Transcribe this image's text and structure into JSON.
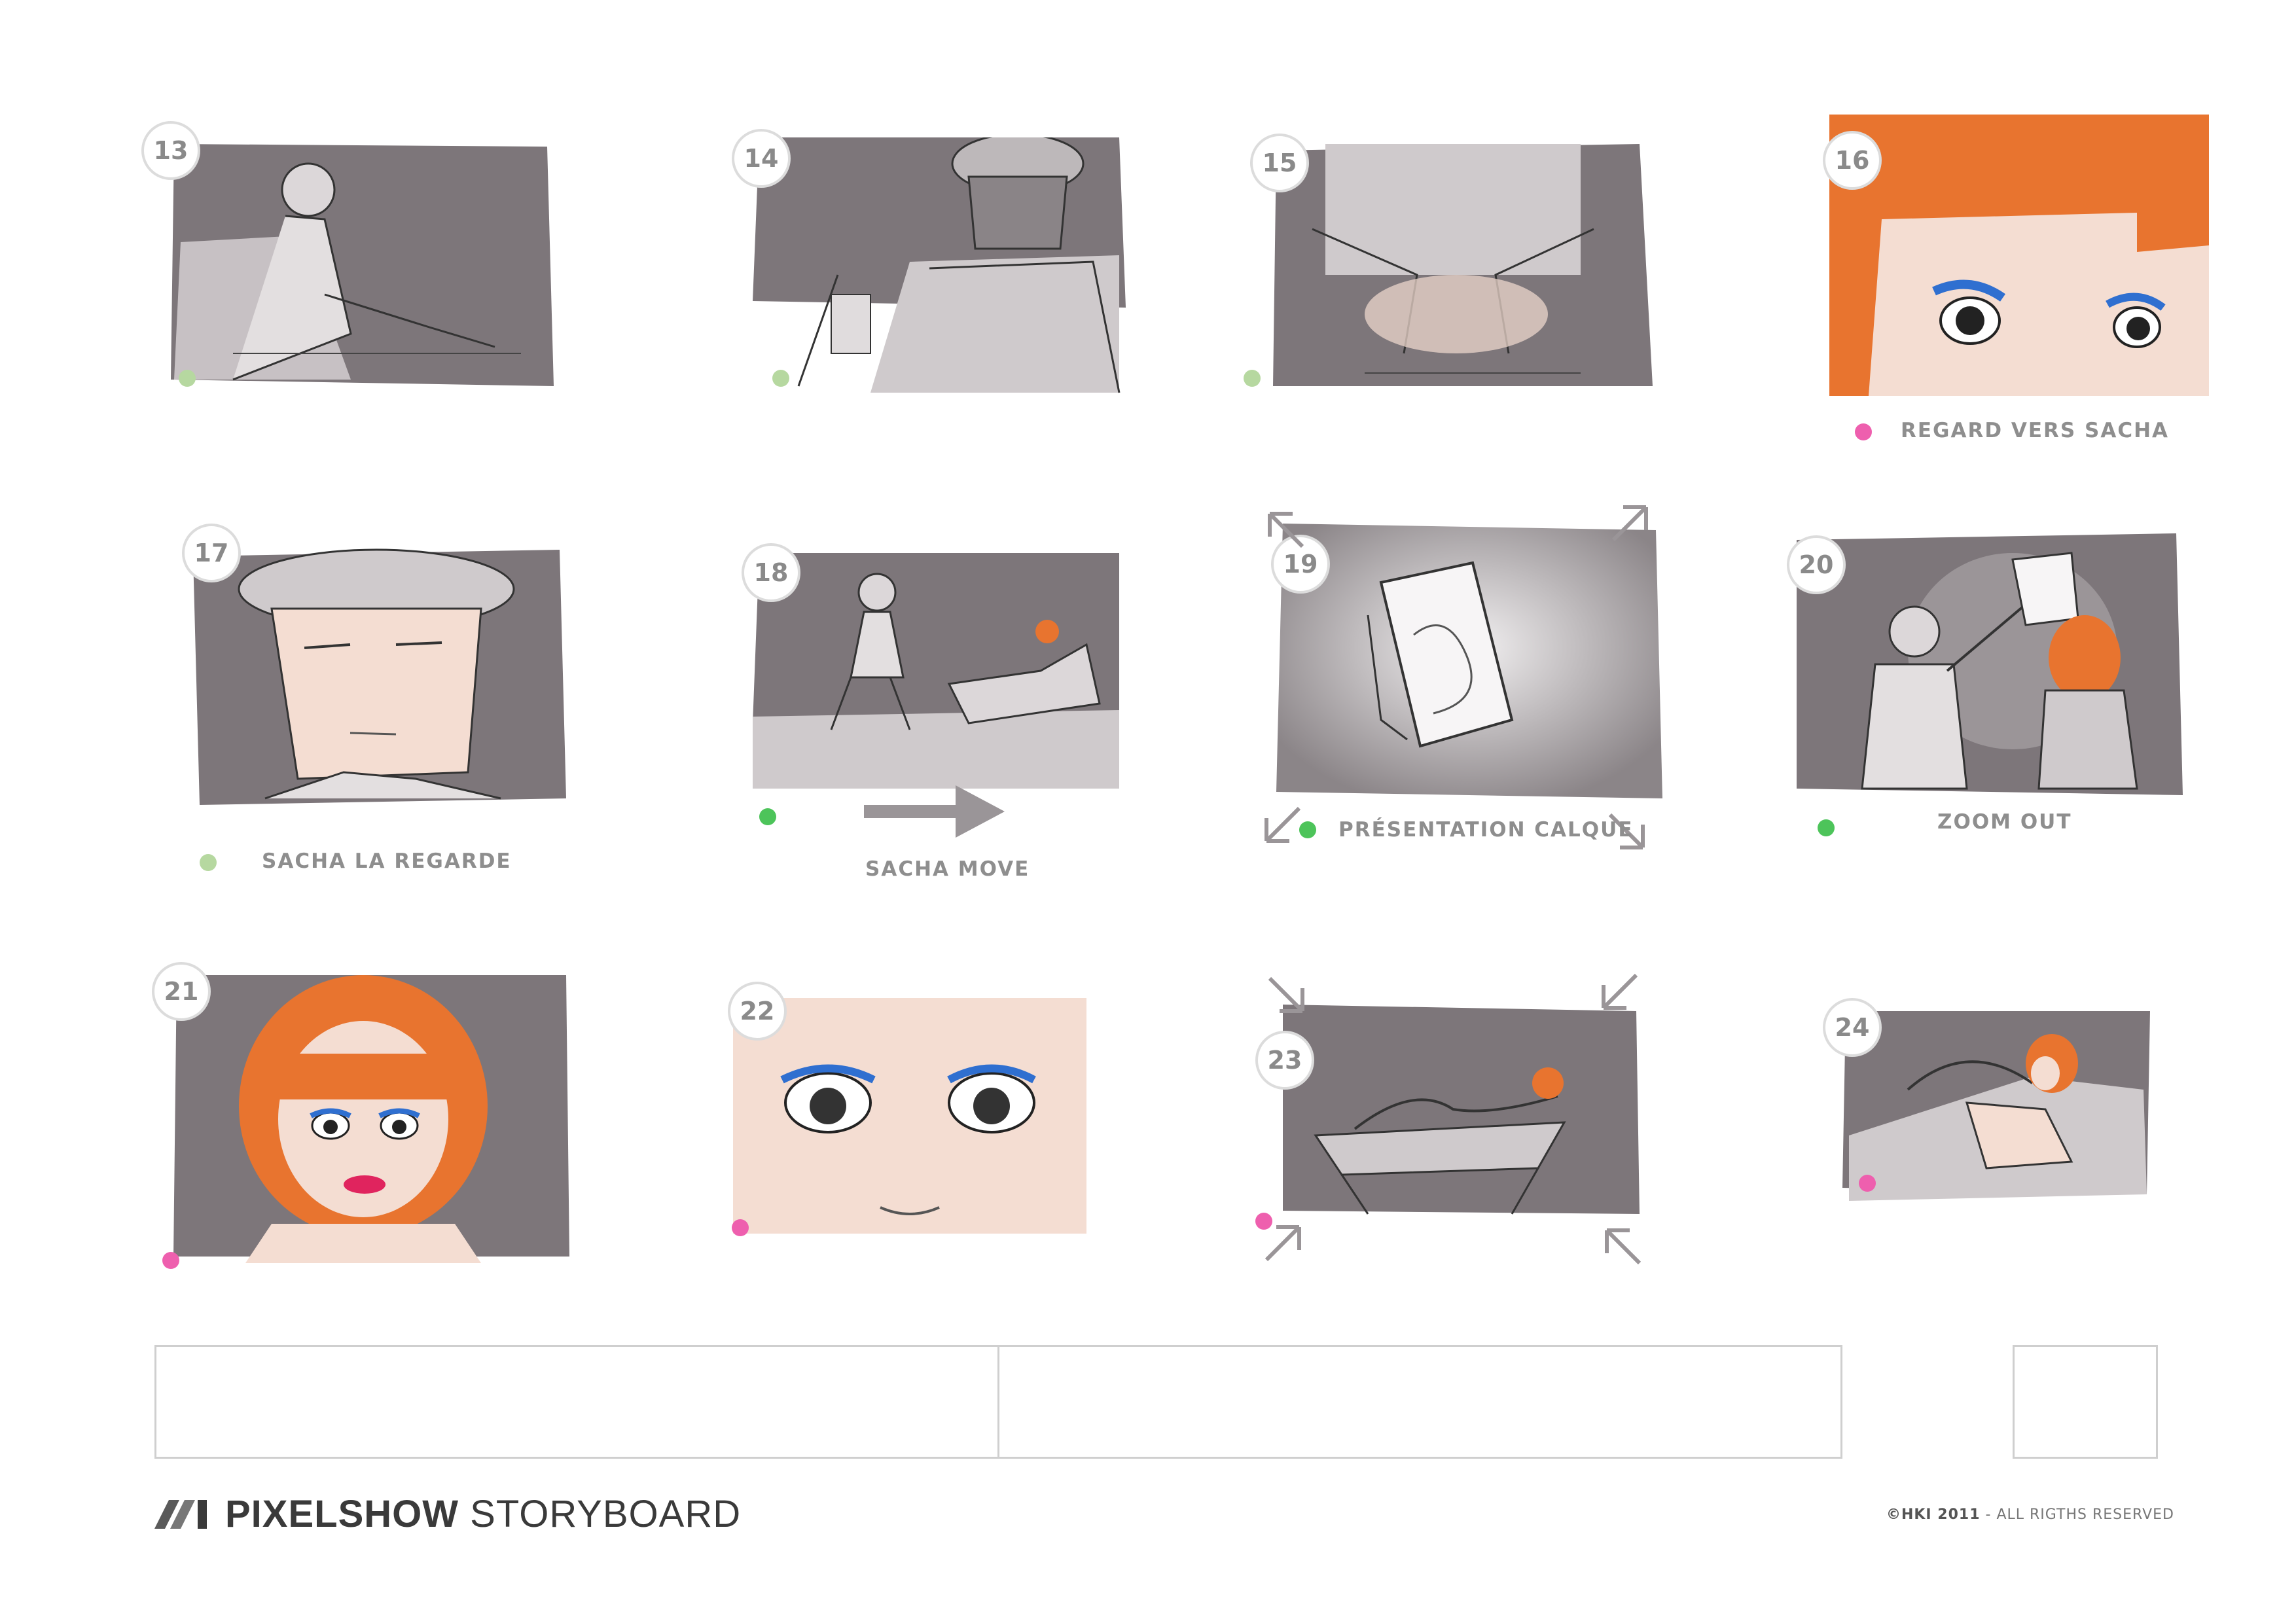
{
  "colors": {
    "wash_dark": "#7d767a",
    "wash_light": "#cfcacc",
    "skin": "#f4ddd2",
    "hair": "#e8742f",
    "eye_blue": "#2f6fd0",
    "dot_light_green": "#b6d8a0",
    "dot_green": "#4dc45a",
    "dot_pink": "#ee5fae"
  },
  "panels": [
    {
      "number": "13",
      "caption": "",
      "dot": "light-green",
      "scene": "man-seated-side"
    },
    {
      "number": "14",
      "caption": "",
      "dot": "light-green",
      "scene": "man-back-drawing"
    },
    {
      "number": "15",
      "caption": "",
      "dot": "light-green",
      "scene": "hands-over-desk"
    },
    {
      "number": "16",
      "caption": "REGARD VERS SACHA",
      "dot": "pink",
      "scene": "woman-eyes-closeup"
    },
    {
      "number": "17",
      "caption": "SACHA LA REGARDE",
      "dot": "light-green",
      "scene": "sacha-face"
    },
    {
      "number": "18",
      "caption": "SACHA MOVE",
      "dot": "green",
      "scene": "two-chairs-wide",
      "has_move_arrow": true
    },
    {
      "number": "19",
      "caption": "PRÉSENTATION CALQUE",
      "dot": "green",
      "scene": "tracing-paper",
      "corner_arrows": "out"
    },
    {
      "number": "20",
      "caption": "ZOOM OUT",
      "dot": "green",
      "scene": "man-shows-paper"
    },
    {
      "number": "21",
      "caption": "",
      "dot": "pink",
      "scene": "woman-portrait"
    },
    {
      "number": "22",
      "caption": "",
      "dot": "pink",
      "scene": "eyes-extreme-closeup"
    },
    {
      "number": "23",
      "caption": "",
      "dot": "pink",
      "scene": "woman-reclining-chair",
      "corner_arrows": "in"
    },
    {
      "number": "24",
      "caption": "",
      "dot": "pink",
      "scene": "woman-lying-pose"
    }
  ],
  "footer": {
    "brand_bold": "PIXELSHOW",
    "brand_light": "STORYBOARD",
    "copyright_bold": "©HKI 2011",
    "copyright_rest": " - ALL RIGTHS RESERVED"
  }
}
